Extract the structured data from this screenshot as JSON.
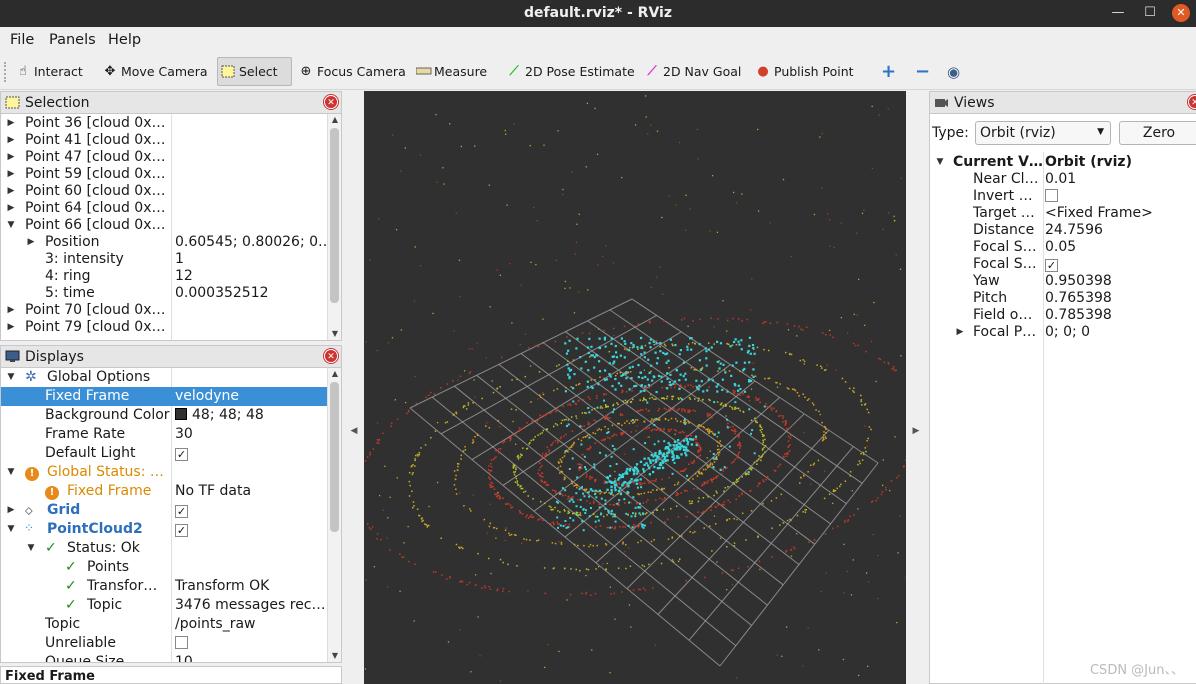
{
  "window": {
    "title": "default.rviz* - RViz"
  },
  "menu": {
    "file": "File",
    "panels": "Panels",
    "help": "Help"
  },
  "toolbar": {
    "interact": "Interact",
    "move_camera": "Move Camera",
    "select": "Select",
    "focus_camera": "Focus Camera",
    "measure": "Measure",
    "pose_estimate": "2D Pose Estimate",
    "nav_goal": "2D Nav Goal",
    "publish_point": "Publish Point"
  },
  "selection": {
    "title": "Selection",
    "rows": [
      {
        "label": "Point 36 [cloud 0x…",
        "value": ""
      },
      {
        "label": "Point 41 [cloud 0x…",
        "value": ""
      },
      {
        "label": "Point 47 [cloud 0x…",
        "value": ""
      },
      {
        "label": "Point 59 [cloud 0x…",
        "value": ""
      },
      {
        "label": "Point 60 [cloud 0x…",
        "value": ""
      },
      {
        "label": "Point 64 [cloud 0x…",
        "value": ""
      },
      {
        "label": "Point 66 [cloud 0x…",
        "value": ""
      },
      {
        "label": "Position",
        "value": "0.60545; 0.80026; 0…"
      },
      {
        "label": "3: intensity",
        "value": "1"
      },
      {
        "label": "4: ring",
        "value": "12"
      },
      {
        "label": "5: time",
        "value": "0.000352512"
      },
      {
        "label": "Point 70 [cloud 0x…",
        "value": ""
      },
      {
        "label": "Point 79 [cloud 0x…",
        "value": ""
      }
    ]
  },
  "displays": {
    "title": "Displays",
    "global_options": "Global Options",
    "fixed_frame_label": "Fixed Frame",
    "fixed_frame_value": "velodyne",
    "bg_color_label": "Background Color",
    "bg_color_value": "48; 48; 48",
    "bg_color_swatch": "#303030",
    "frame_rate_label": "Frame Rate",
    "frame_rate_value": "30",
    "default_light_label": "Default Light",
    "global_status_label": "Global Status: …",
    "gs_fixed_frame_label": "Fixed Frame",
    "gs_fixed_frame_value": "No TF data",
    "grid_label": "Grid",
    "pointcloud_label": "PointCloud2",
    "status_ok": "Status: Ok",
    "points_label": "Points",
    "transform_label": "Transfor…",
    "transform_value": "Transform OK",
    "topic_status_label": "Topic",
    "topic_status_value": "3476 messages rec…",
    "topic_label": "Topic",
    "topic_value": "/points_raw",
    "unreliable_label": "Unreliable",
    "queue_size_label": "Queue Size",
    "queue_size_value": "10",
    "footer": "Fixed Frame"
  },
  "views": {
    "title": "Views",
    "type_label": "Type:",
    "type_value": "Orbit (rviz)",
    "zero_button": "Zero",
    "current_view_label": "Current V…",
    "current_view_value": "Orbit (rviz)",
    "rows": [
      {
        "label": "Near Cl…",
        "value": "0.01"
      },
      {
        "label": "Invert …",
        "value": ""
      },
      {
        "label": "Target …",
        "value": "<Fixed Frame>"
      },
      {
        "label": "Distance",
        "value": "24.7596"
      },
      {
        "label": "Focal S…",
        "value": "0.05"
      },
      {
        "label": "Focal S…",
        "value": ""
      },
      {
        "label": "Yaw",
        "value": "0.950398"
      },
      {
        "label": "Pitch",
        "value": "0.765398"
      },
      {
        "label": "Field o…",
        "value": "0.785398"
      },
      {
        "label": "Focal P…",
        "value": "0; 0; 0"
      }
    ]
  },
  "watermark": "CSDN @Jun、、"
}
